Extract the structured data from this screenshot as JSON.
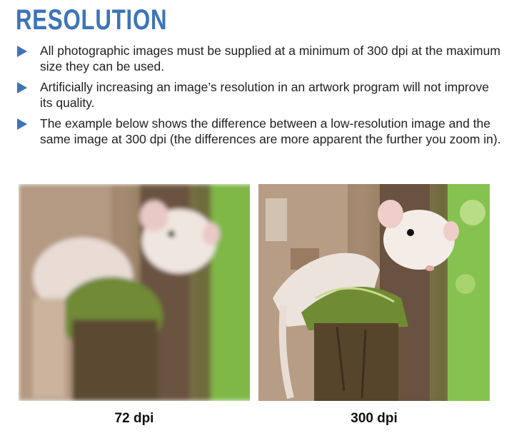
{
  "heading": "RESOLUTION",
  "bullets": [
    "All photographic images must be supplied at a minimum of 300 dpi at the maximum size they can be used.",
    "Artificially increasing an image’s resolution in an artwork program will not improve its quality.",
    "The example below shows the difference between a low-resolution image and the same image at 300 dpi (the differences are more apparent the further you zoom in)."
  ],
  "images": [
    {
      "caption": "72 dpi",
      "quality": "low-resolution"
    },
    {
      "caption": "300 dpi",
      "quality": "high-resolution"
    }
  ],
  "colors": {
    "accent": "#3d74b8"
  }
}
